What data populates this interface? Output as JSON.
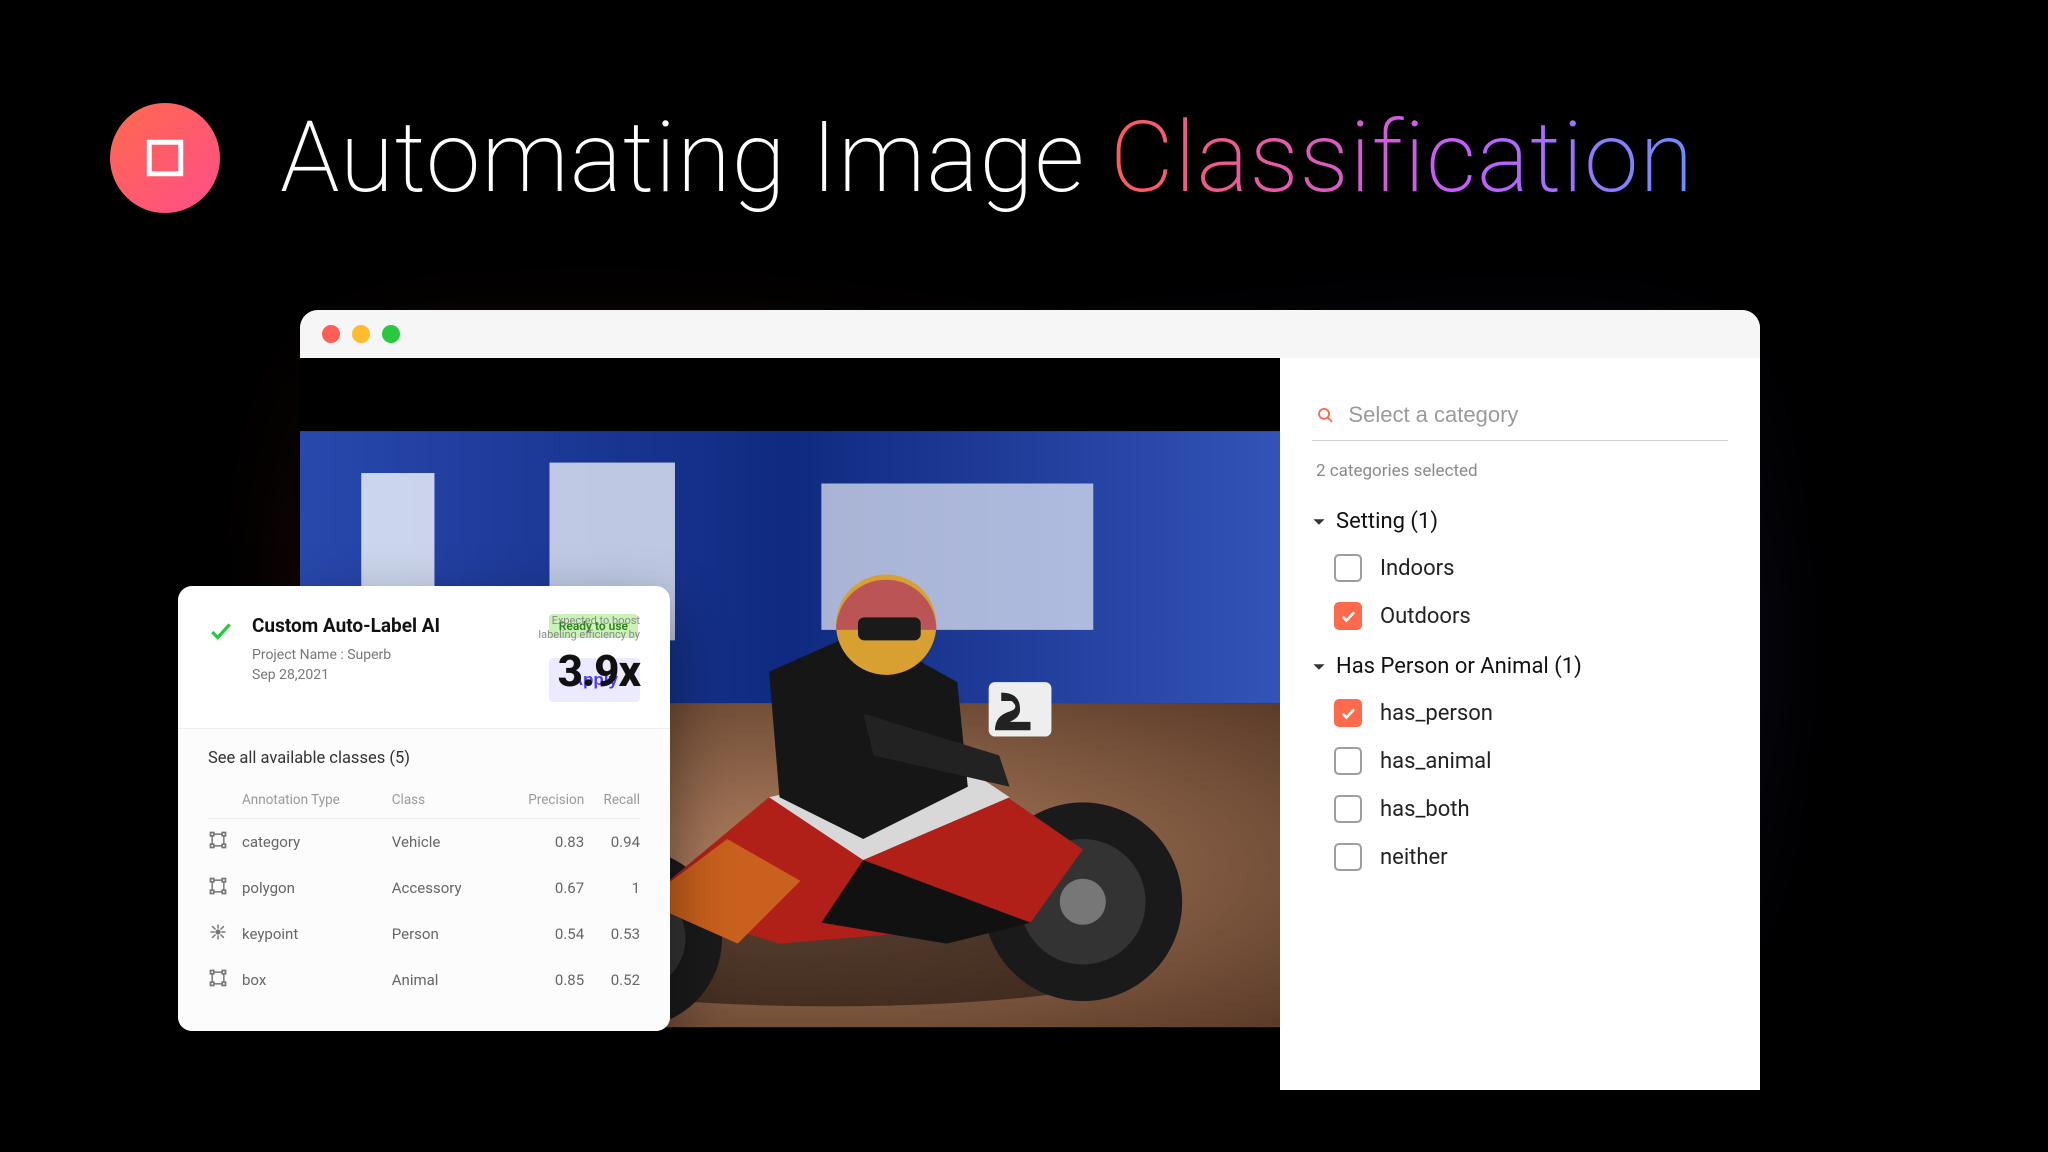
{
  "header": {
    "title_a": "Automating Image ",
    "title_b": "Classification"
  },
  "side": {
    "search_placeholder": "Select a category",
    "selected_count": "2 categories selected",
    "groups": [
      {
        "name": "Setting",
        "count": 1,
        "options": [
          {
            "label": "Indoors",
            "checked": false
          },
          {
            "label": "Outdoors",
            "checked": true
          }
        ]
      },
      {
        "name": "Has Person or Animal",
        "count": 1,
        "options": [
          {
            "label": "has_person",
            "checked": true
          },
          {
            "label": "has_animal",
            "checked": false
          },
          {
            "label": "has_both",
            "checked": false
          },
          {
            "label": "neither",
            "checked": false
          }
        ]
      }
    ]
  },
  "card": {
    "title": "Custom Auto-Label AI",
    "project_line": "Project Name : Superb",
    "date_line": "Sep 28,2021",
    "badge": "Ready to use",
    "apply_label": "Apply",
    "boost_label_a": "Expected to boost",
    "boost_label_b": "labeling efficiency by",
    "boost_value": "3.9x",
    "available": "See all available classes (5)",
    "columns": [
      "Annotation Type",
      "Class",
      "Precision",
      "Recall"
    ],
    "rows": [
      {
        "icon": "square",
        "type": "category",
        "class": "Vehicle",
        "precision": "0.83",
        "recall": "0.94"
      },
      {
        "icon": "square",
        "type": "polygon",
        "class": "Accessory",
        "precision": "0.67",
        "recall": "1"
      },
      {
        "icon": "star",
        "type": "keypoint",
        "class": "Person",
        "precision": "0.54",
        "recall": "0.53"
      },
      {
        "icon": "square",
        "type": "box",
        "class": "Animal",
        "precision": "0.85",
        "recall": "0.52"
      }
    ]
  }
}
